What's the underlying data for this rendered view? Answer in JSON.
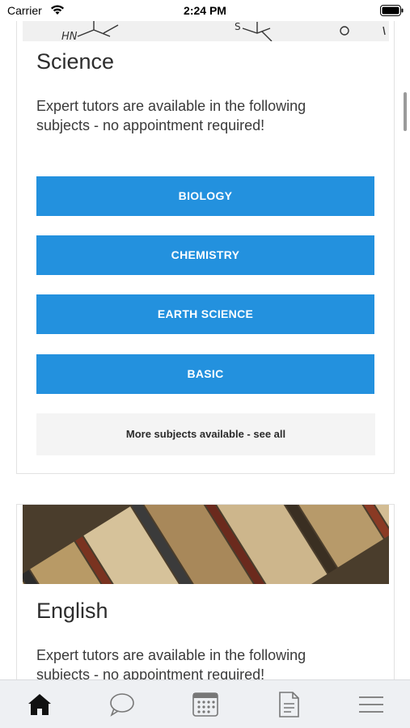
{
  "status_bar": {
    "carrier": "Carrier",
    "time": "2:24 PM"
  },
  "science": {
    "title": "Science",
    "description": "Expert tutors are available in the following subjects - no appointment required!",
    "subjects": [
      "BIOLOGY",
      "CHEMISTRY",
      "EARTH SCIENCE",
      "BASIC"
    ],
    "more_label": "More subjects available - see all",
    "image_icon": "chemical-structure-image"
  },
  "english": {
    "title": "English",
    "description": "Expert tutors are available in the following subjects - no appointment required!",
    "image_icon": "books-image"
  },
  "tab_bar": {
    "items": [
      {
        "icon": "home-icon",
        "active": true
      },
      {
        "icon": "chat-icon",
        "active": false
      },
      {
        "icon": "calendar-icon",
        "active": false
      },
      {
        "icon": "document-icon",
        "active": false
      },
      {
        "icon": "menu-icon",
        "active": false
      }
    ]
  },
  "colors": {
    "accent": "#2391de",
    "more_bg": "#f4f4f4",
    "tab_bg": "#eef0f3"
  }
}
